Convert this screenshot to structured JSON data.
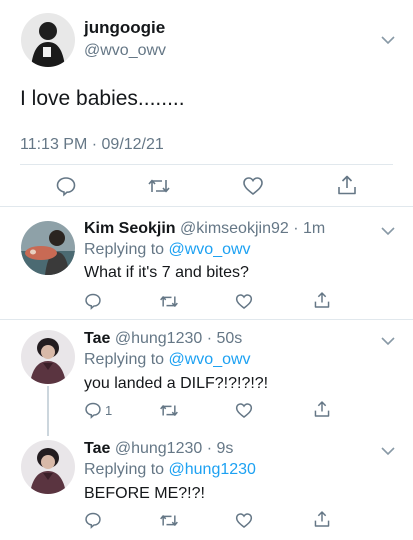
{
  "main_tweet": {
    "display_name": "jungoogie",
    "handle": "@wvo_owv",
    "text": "I love babies........",
    "timestamp": "11:13 PM · 09/12/21",
    "icons": [
      "reply-icon",
      "retweet-icon",
      "like-icon",
      "share-icon",
      "chevron-down-icon"
    ]
  },
  "replies": [
    {
      "display_name": "Kim Seokjin",
      "meta": "@kimseokjin92 · 1m",
      "replying_prefix": "Replying to ",
      "replying_to": "@wvo_owv",
      "text": "What if it's 7 and bites?",
      "reply_count": ""
    },
    {
      "display_name": "Tae",
      "meta": "@hung1230 · 50s",
      "replying_prefix": "Replying to ",
      "replying_to": "@wvo_owv",
      "text": "you landed a DILF?!?!?!?!",
      "reply_count": "1"
    },
    {
      "display_name": "Tae",
      "meta": "@hung1230 · 9s",
      "replying_prefix": "Replying to ",
      "replying_to": "@hung1230",
      "text": "BEFORE ME?!?!",
      "reply_count": ""
    }
  ],
  "colors": {
    "text": "#14171a",
    "secondary": "#657786",
    "link": "#1da1f2",
    "border": "#e1e8ed"
  }
}
